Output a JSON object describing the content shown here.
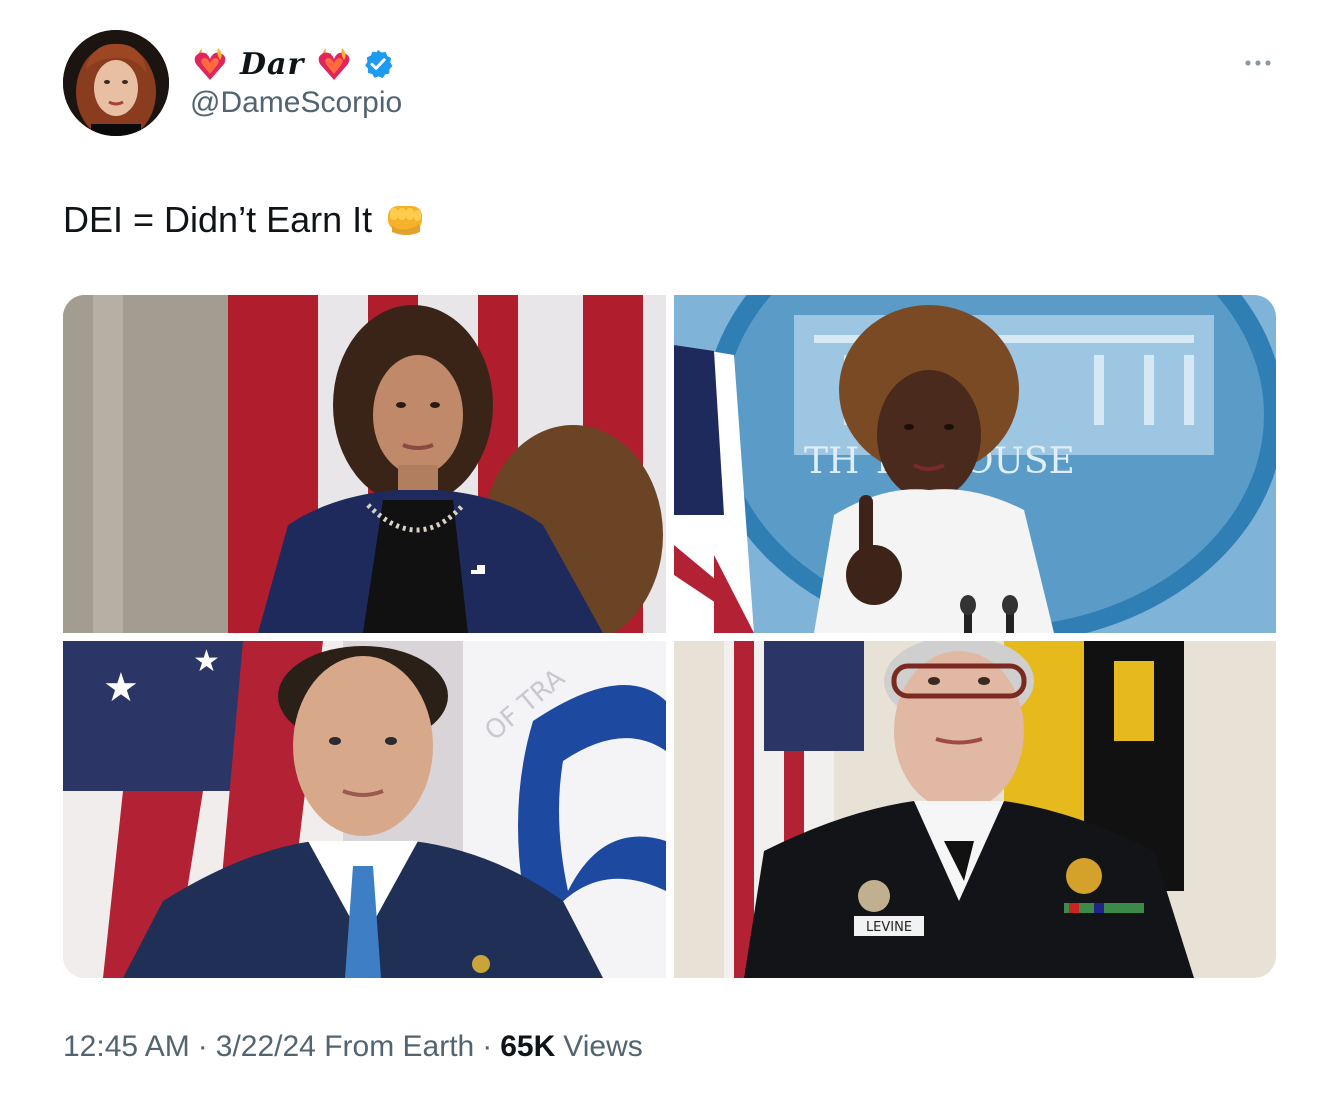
{
  "author": {
    "display_name": "Dar",
    "handle": "@DameScorpio",
    "verified": true,
    "name_emoji": "heart-on-fire",
    "avatar_icon": "avatar"
  },
  "tweet": {
    "text": "DEI = Didn’t Earn It",
    "text_emoji": "oncoming-fist"
  },
  "media": {
    "photos": [
      {
        "label_icon": "photo-1"
      },
      {
        "label_icon": "photo-2",
        "sign_text": "TH      TE HOUSE"
      },
      {
        "label_icon": "photo-3",
        "sign_text": "OF TRA"
      },
      {
        "label_icon": "photo-4",
        "badge_text": "LEVINE"
      }
    ]
  },
  "meta": {
    "time": "12:45 AM",
    "separator": "·",
    "date_source": "3/22/24 From Earth",
    "views_count": "65K",
    "views_label": "Views"
  },
  "colors": {
    "text_primary": "#0f1419",
    "text_secondary": "#536471",
    "verified_blue": "#1d9bf0",
    "flag_red": "#b22234",
    "navy": "#1f2a5c"
  },
  "icons": {
    "more": "more-icon",
    "verified": "verified-badge-icon"
  }
}
